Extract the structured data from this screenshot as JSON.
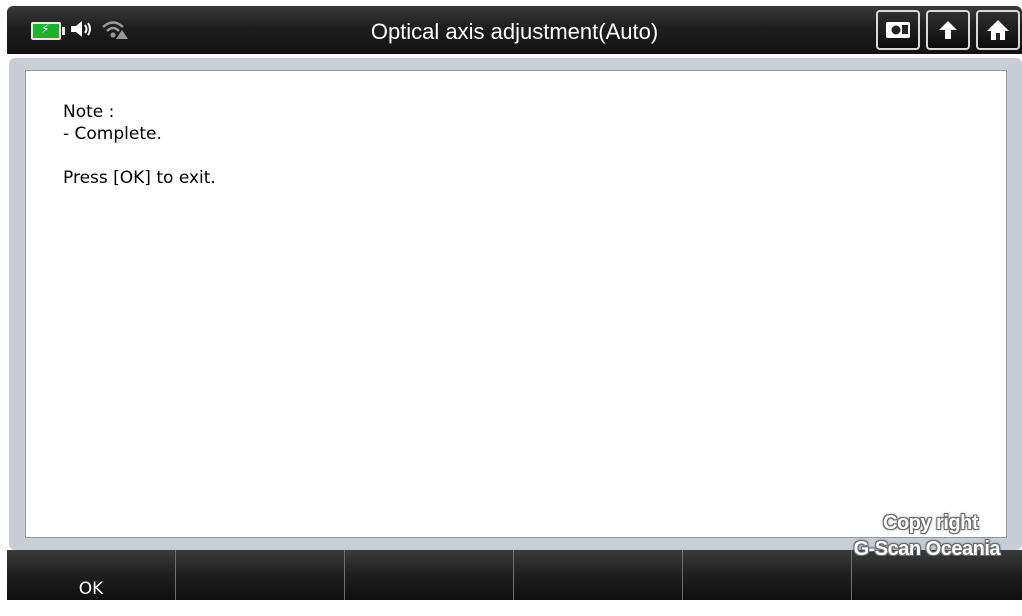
{
  "window": {
    "title": "Optical axis adjustment(Auto)"
  },
  "statusbar": {
    "icons": [
      "battery-charging-icon",
      "speaker-icon",
      "wifi-warning-icon"
    ]
  },
  "toolbar": {
    "icons": [
      "screen-capture-icon",
      "back-arrow-icon",
      "home-icon"
    ]
  },
  "message": {
    "lines": [
      "Note :",
      "- Complete.",
      "",
      "Press [OK] to exit."
    ]
  },
  "watermark": {
    "line1": "Copy right",
    "line2": "G-Scan Oceania"
  },
  "softkeys": [
    "OK",
    "",
    "",
    "",
    "",
    ""
  ],
  "colors": {
    "battery": "#17b52c",
    "titlebar": "#1e1e1e",
    "frame": "#c9ced6"
  }
}
